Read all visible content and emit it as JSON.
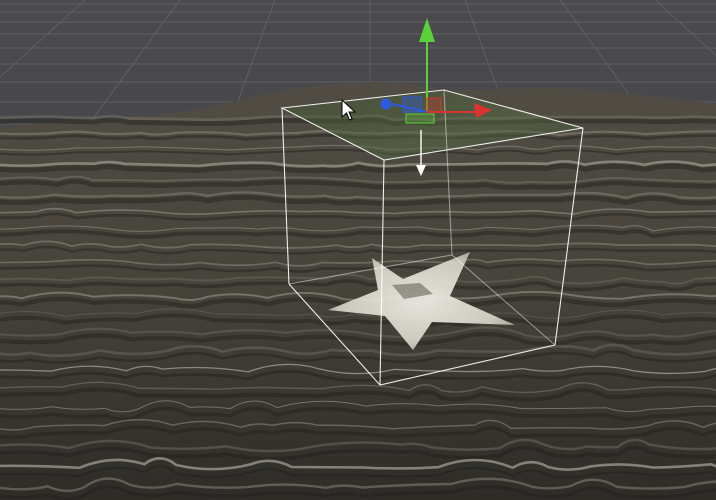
{
  "app": {
    "view": "scene-viewport"
  },
  "scene": {
    "background_color": "#47474a",
    "grid_line_color": "#6a6a70",
    "terrain_base_color": "#4c4941",
    "terrain_highlight_color": "#d6d2c3",
    "terrain_shadow_color": "#23221e",
    "projected_top_color": "#4d5e3b",
    "decal_shape": "star",
    "decal_color": "#e9e7dc",
    "projector_bounds_color": "#ffffff"
  },
  "gizmo": {
    "mode": "translate",
    "axes": [
      {
        "axis": "y",
        "color": "#5ad03a",
        "icon": "arrow-up-icon"
      },
      {
        "axis": "x",
        "color": "#d9342e",
        "icon": "arrow-right-icon"
      },
      {
        "axis": "z",
        "color": "#2d5be0",
        "icon": "arrow-forward-icon"
      }
    ],
    "direction_marker_color": "#ffffff"
  },
  "cursor": {
    "icon": "mouse-pointer-icon"
  }
}
